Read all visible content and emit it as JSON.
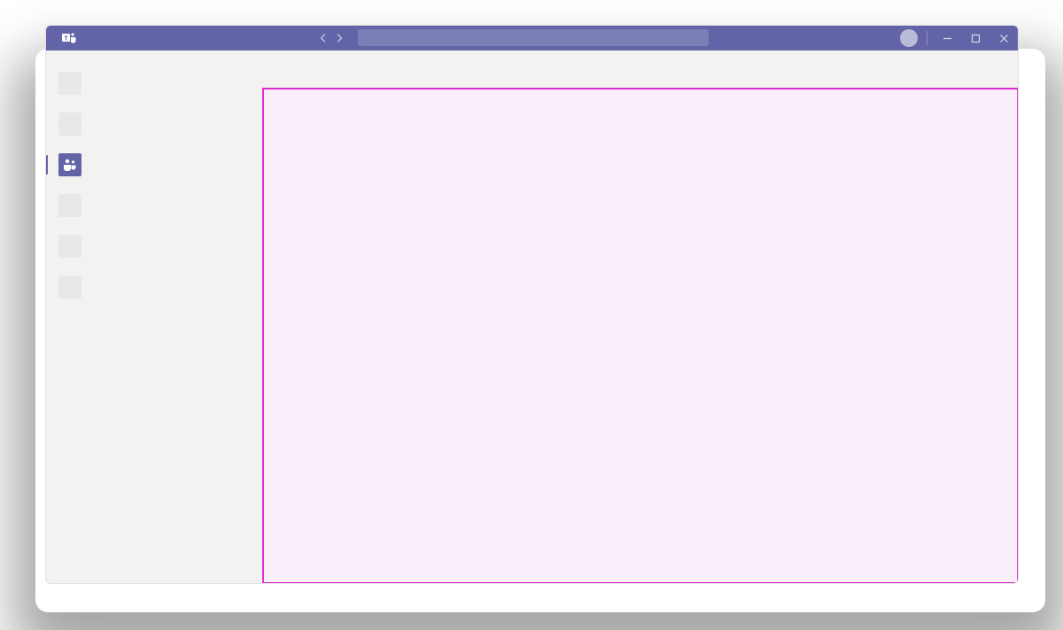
{
  "colors": {
    "brand": "#6264a7",
    "highlight_border": "#dd2fd0",
    "highlight_fill": "#f9effa",
    "app_bg": "#f3f2f1"
  },
  "window_controls": {
    "minimize": "−",
    "maximize": "□",
    "close": "✕"
  },
  "search": {
    "value": ""
  },
  "left_rail": {
    "items": [
      {
        "id": "item-1",
        "active": false
      },
      {
        "id": "item-2",
        "active": false
      },
      {
        "id": "teams",
        "active": true,
        "icon": "teams-icon"
      },
      {
        "id": "item-4",
        "active": false
      },
      {
        "id": "item-5",
        "active": false
      },
      {
        "id": "item-6",
        "active": false
      }
    ]
  }
}
